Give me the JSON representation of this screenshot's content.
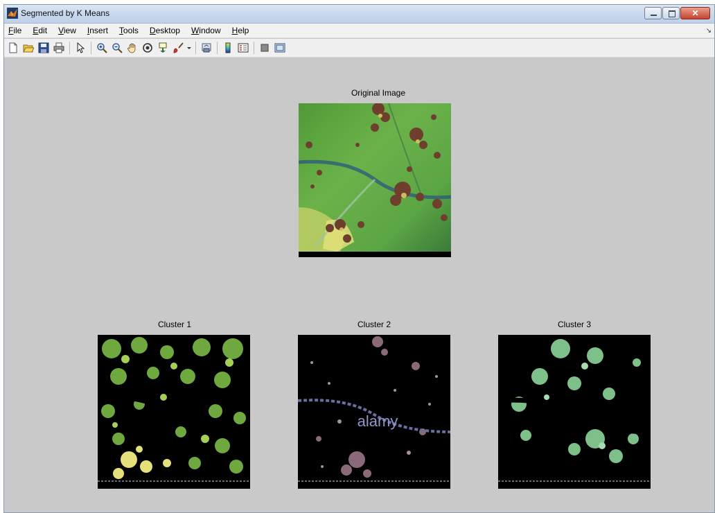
{
  "window": {
    "title": "Segmented by K Means",
    "close_glyph": "✕"
  },
  "menu": [
    {
      "label": "File",
      "mnemonic": "F",
      "rest": "ile"
    },
    {
      "label": "Edit",
      "mnemonic": "E",
      "rest": "dit"
    },
    {
      "label": "View",
      "mnemonic": "V",
      "rest": "iew"
    },
    {
      "label": "Insert",
      "mnemonic": "I",
      "rest": "nsert"
    },
    {
      "label": "Tools",
      "mnemonic": "T",
      "rest": "ools"
    },
    {
      "label": "Desktop",
      "mnemonic": "D",
      "rest": "esktop"
    },
    {
      "label": "Window",
      "mnemonic": "W",
      "rest": "indow"
    },
    {
      "label": "Help",
      "mnemonic": "H",
      "rest": "elp"
    }
  ],
  "menu_dock_glyph": "↘",
  "toolbar": {
    "icons": [
      "new-figure-icon",
      "open-file-icon",
      "save-icon",
      "print-icon",
      "edit-plot-arrow-icon",
      "zoom-in-icon",
      "zoom-out-icon",
      "pan-hand-icon",
      "rotate-3d-icon",
      "data-cursor-icon",
      "brush-icon",
      "link-plot-icon",
      "colorbar-icon",
      "legend-icon",
      "hide-plot-tools-icon",
      "show-plot-tools-icon"
    ]
  },
  "figure": {
    "original_title": "Original Image",
    "clusters": [
      {
        "title": "Cluster 1"
      },
      {
        "title": "Cluster 2"
      },
      {
        "title": "Cluster 3"
      }
    ],
    "image_watermark": "alamy"
  },
  "colors": {
    "figure_bg": "#c9c9c9",
    "leaf_green": "#5fa83a",
    "leaf_yellow": "#e6e07a",
    "spot_brown": "#6e3f2c",
    "cluster3_green": "#7ec08a"
  }
}
